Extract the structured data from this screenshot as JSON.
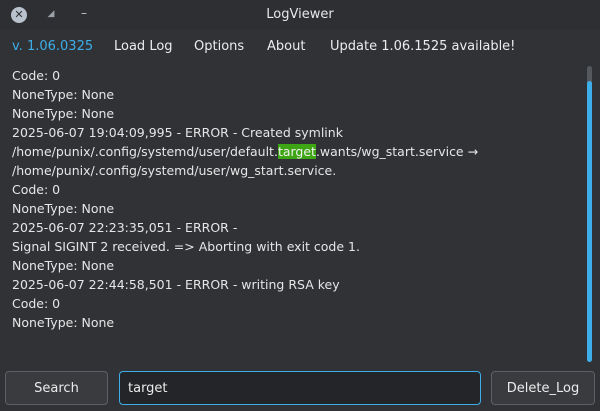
{
  "window": {
    "title": "LogViewer",
    "close_icon": "close-icon",
    "sticky_icon": "sticky-icon",
    "minimize_icon": "minimize-icon"
  },
  "menu": {
    "version": "v. 1.06.0325",
    "load_log": "Load Log",
    "options": "Options",
    "about": "About",
    "update": "Update 1.06.1525 available!"
  },
  "log": {
    "lines": [
      {
        "text": " Code: 0"
      },
      {
        "text": "NoneType: None"
      },
      {
        "text": "NoneType: None"
      },
      {
        "text": "2025-06-07 19:04:09,995 - ERROR - Created symlink"
      },
      {
        "before": "/home/punix/.config/systemd/user/default.",
        "match": "target",
        "after": ".wants/wg_start.service →"
      },
      {
        "text": "/home/punix/.config/systemd/user/wg_start.service."
      },
      {
        "text": " Code: 0"
      },
      {
        "text": "NoneType: None"
      },
      {
        "text": "2025-06-07 22:23:35,051 - ERROR -"
      },
      {
        "text": "Signal SIGINT 2 received. => Aborting with exit code 1."
      },
      {
        "text": "NoneType: None"
      },
      {
        "text": "2025-06-07 22:44:58,501 - ERROR - writing RSA key"
      },
      {
        "text": " Code: 0"
      },
      {
        "text": "NoneType: None"
      }
    ],
    "highlight_color": "#3ea614"
  },
  "scrollbar": {
    "position_fraction": 0.99,
    "visible_fraction": 0.1
  },
  "controls": {
    "search_label": "Search",
    "search_value": "target",
    "delete_label": "Delete_Log"
  },
  "colors": {
    "accent": "#3daee9",
    "background": "#303236"
  }
}
